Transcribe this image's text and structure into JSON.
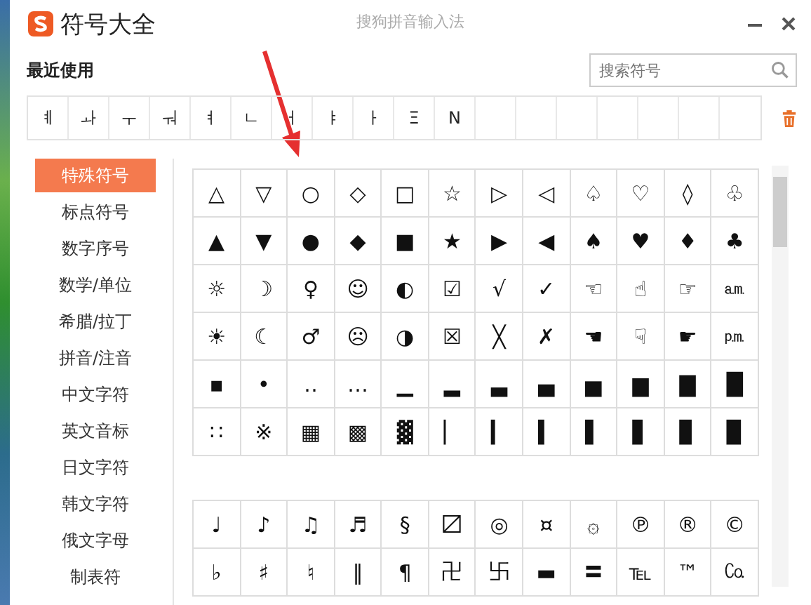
{
  "window": {
    "app_name": "符号大全",
    "title": "搜狗拼音输入法"
  },
  "recent": {
    "label": "最近使用",
    "symbols": [
      "ㅖ",
      "ㅘ",
      "ㅜ",
      "ㅝ",
      "ㅕ",
      "ㄴ",
      "ㅓ",
      "ㅑ",
      "ㅏ",
      "Ξ",
      "N"
    ]
  },
  "search": {
    "placeholder": "搜索符号"
  },
  "sidebar": {
    "items": [
      {
        "label": "特殊符号",
        "selected": true
      },
      {
        "label": "标点符号",
        "selected": false
      },
      {
        "label": "数字序号",
        "selected": false
      },
      {
        "label": "数学/单位",
        "selected": false
      },
      {
        "label": "希腊/拉丁",
        "selected": false
      },
      {
        "label": "拼音/注音",
        "selected": false
      },
      {
        "label": "中文字符",
        "selected": false
      },
      {
        "label": "英文音标",
        "selected": false
      },
      {
        "label": "日文字符",
        "selected": false
      },
      {
        "label": "韩文字符",
        "selected": false
      },
      {
        "label": "俄文字母",
        "selected": false
      },
      {
        "label": "制表符",
        "selected": false
      }
    ]
  },
  "symbol_groups": [
    {
      "rows": [
        [
          "△",
          "▽",
          "○",
          "◇",
          "□",
          "☆",
          "▷",
          "◁",
          "♤",
          "♡",
          "◊",
          "♧"
        ],
        [
          "▲",
          "▼",
          "●",
          "◆",
          "■",
          "★",
          "▶",
          "◀",
          "♠",
          "♥",
          "♦",
          "♣"
        ],
        [
          "☼",
          "☽",
          "♀",
          "☺",
          "◐",
          "☑",
          "√",
          "✓",
          "☜",
          "☝",
          "☞",
          "㏂"
        ],
        [
          "☀",
          "☾",
          "♂",
          "☹",
          "◑",
          "☒",
          "╳",
          "✗",
          "☚",
          "☟",
          "☛",
          "㏘"
        ],
        [
          "▪",
          "•",
          "‥",
          "…",
          "▁",
          "▂",
          "▃",
          "▄",
          "▅",
          "▆",
          "▇",
          "█"
        ],
        [
          "∷",
          "※",
          "▦",
          "▩",
          "▓",
          "▏",
          "▎",
          "▍",
          "▌",
          "▋",
          "▊",
          "▉"
        ]
      ]
    },
    {
      "rows": [
        [
          "♩",
          "♪",
          "♫",
          "♬",
          "§",
          "〼",
          "◎",
          "¤",
          "۞",
          "℗",
          "®",
          "©"
        ],
        [
          "♭",
          "♯",
          "♮",
          "‖",
          "¶",
          "卍",
          "卐",
          "▬",
          "〓",
          "℡",
          "™",
          "㏇"
        ]
      ]
    }
  ]
}
